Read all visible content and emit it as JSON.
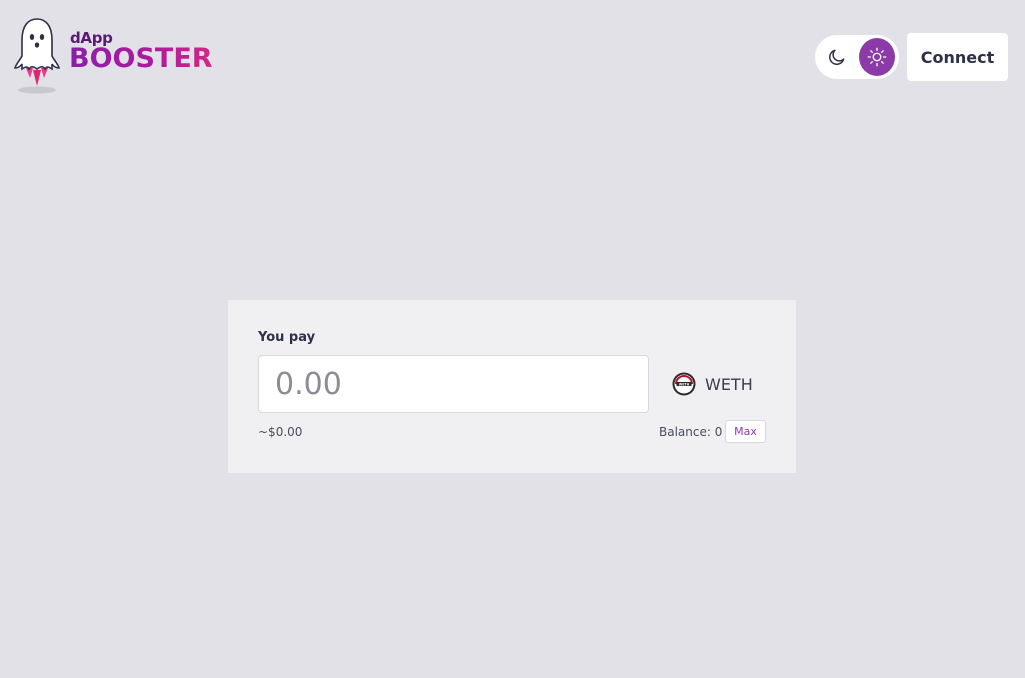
{
  "header": {
    "logo": {
      "small_text": "dApp",
      "big_text": "BOOSTER"
    },
    "theme_toggle": {
      "dark_icon": "moon-icon",
      "light_icon": "sun-icon",
      "active": "light"
    },
    "connect_label": "Connect"
  },
  "swap": {
    "label": "You pay",
    "amount_placeholder": "0.00",
    "amount_value": "",
    "token": {
      "name": "WETH",
      "icon": "weth-token-icon"
    },
    "usd_value": "~$0.00",
    "balance_text": "Balance: 0",
    "max_label": "Max"
  },
  "colors": {
    "background": "#e2e1e7",
    "card": "#f0f0f2",
    "accent": "#8b3aa8",
    "text": "#2e3048"
  }
}
